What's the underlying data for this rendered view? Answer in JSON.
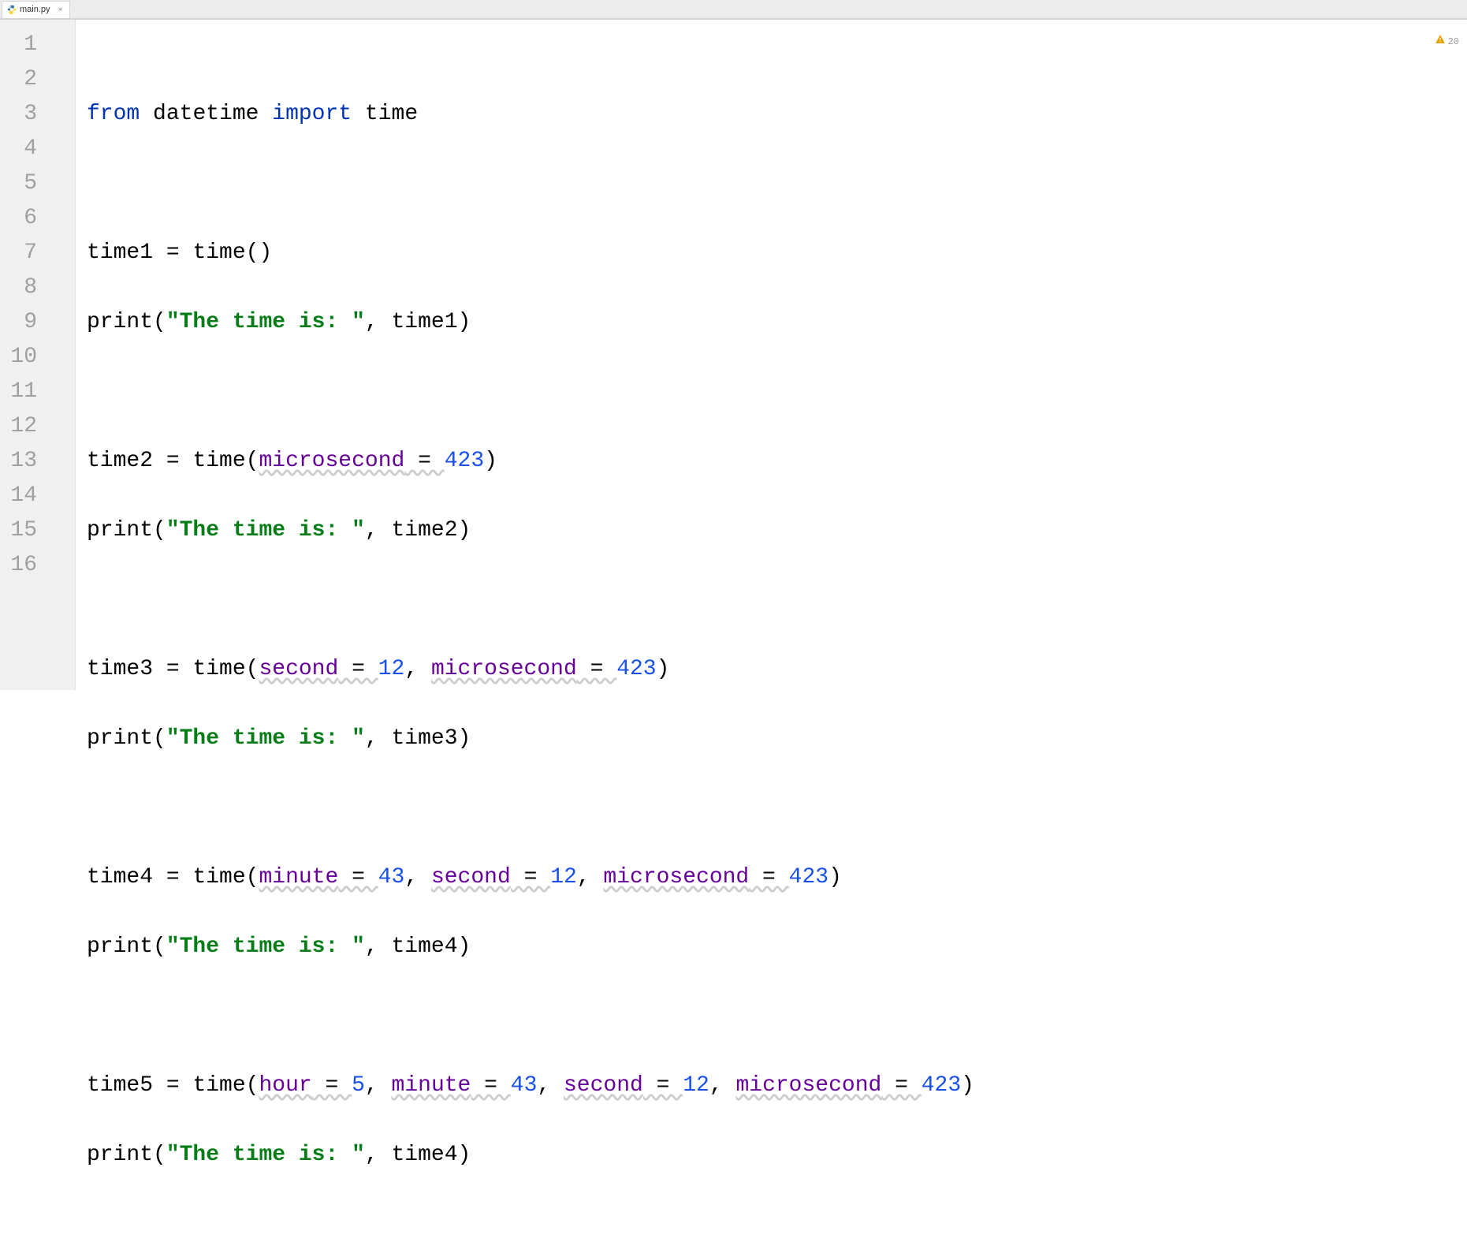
{
  "tab": {
    "filename": "main.py",
    "icon": "python-file-icon"
  },
  "warning": {
    "count": "20"
  },
  "gutter": {
    "lines": [
      "1",
      "2",
      "3",
      "4",
      "5",
      "6",
      "7",
      "8",
      "9",
      "10",
      "11",
      "12",
      "13",
      "14",
      "15",
      "16"
    ]
  },
  "code": {
    "l1": {
      "from": "from",
      "mod": "datetime",
      "import": "import",
      "name": "time"
    },
    "l3": {
      "lhs": "time1 = time()",
      "var": "time1",
      "eq": " = ",
      "call": "time()"
    },
    "l4": {
      "print": "print",
      "open": "(",
      "str": "\"The time is: \"",
      "comma": ", ",
      "arg": "time1",
      "close": ")"
    },
    "l6": {
      "var": "time2",
      "eq": " = ",
      "call": "time",
      "open": "(",
      "p1": "microsecond",
      "sp1": " = ",
      "n1": "423",
      "close": ")"
    },
    "l7": {
      "print": "print",
      "open": "(",
      "str": "\"The time is: \"",
      "comma": ", ",
      "arg": "time2",
      "close": ")"
    },
    "l9": {
      "var": "time3",
      "eq": " = ",
      "call": "time",
      "open": "(",
      "p1": "second",
      "sp1": " = ",
      "n1": "12",
      "c1": ", ",
      "p2": "microsecond",
      "sp2": " = ",
      "n2": "423",
      "close": ")"
    },
    "l10": {
      "print": "print",
      "open": "(",
      "str": "\"The time is: \"",
      "comma": ", ",
      "arg": "time3",
      "close": ")"
    },
    "l12": {
      "var": "time4",
      "eq": " = ",
      "call": "time",
      "open": "(",
      "p1": "minute",
      "sp1": " = ",
      "n1": "43",
      "c1": ", ",
      "p2": "second",
      "sp2": " = ",
      "n2": "12",
      "c2": ", ",
      "p3": "microsecond",
      "sp3": " = ",
      "n3": "423",
      "close": ")"
    },
    "l13": {
      "print": "print",
      "open": "(",
      "str": "\"The time is: \"",
      "comma": ", ",
      "arg": "time4",
      "close": ")"
    },
    "l15": {
      "var": "time5",
      "eq": " = ",
      "call": "time",
      "open": "(",
      "p1": "hour",
      "sp1": " = ",
      "n1": "5",
      "c1": ", ",
      "p2": "minute",
      "sp2": " = ",
      "n2": "43",
      "c2": ", ",
      "p3": "second",
      "sp3": " = ",
      "n3": "12",
      "c3": ", ",
      "p4": "microsecond",
      "sp4": " = ",
      "n4": "423",
      "close": ")"
    },
    "l16": {
      "print": "print",
      "open": "(",
      "str": "\"The time is: \"",
      "comma": ", ",
      "arg": "time4",
      "close": ")"
    }
  }
}
